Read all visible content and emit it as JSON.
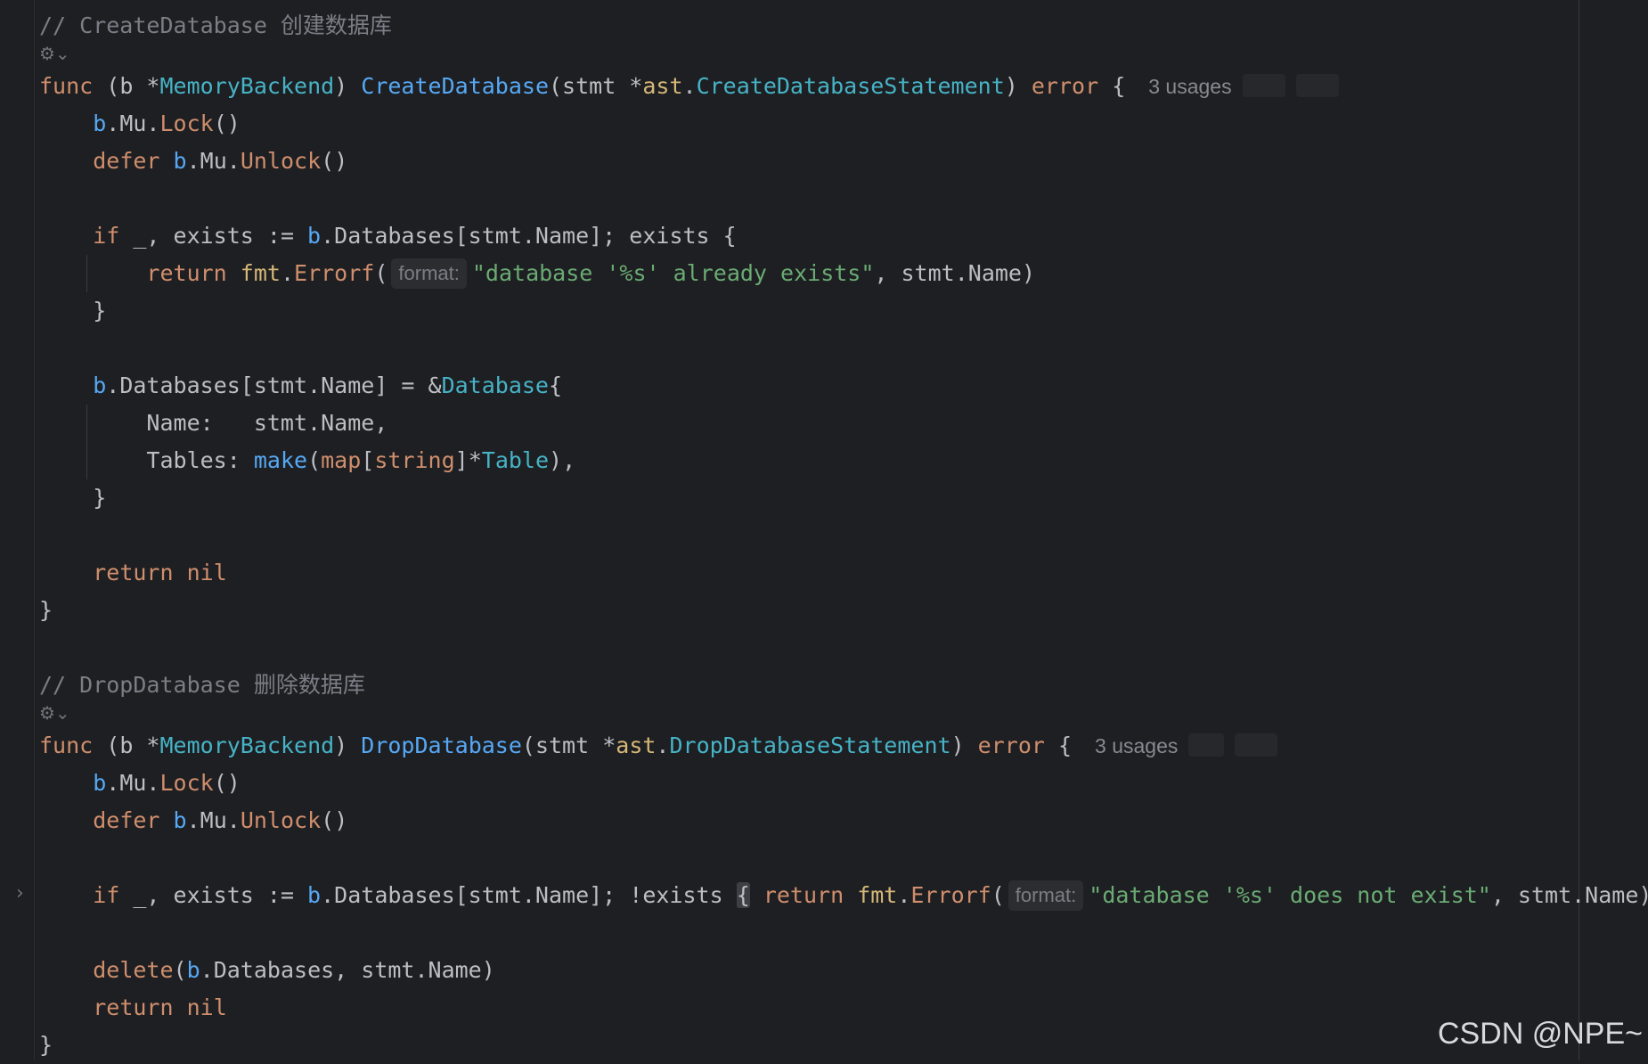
{
  "comment1": "// CreateDatabase 创建数据库",
  "comment2": "// DropDatabase 删除数据库",
  "gutter_icon_symbol": "⚙⌄",
  "usages": "3 usages",
  "hint_format": "format:",
  "create": {
    "recv": "(b *",
    "recv_type": "MemoryBackend",
    "recv_close": ") ",
    "name": "CreateDatabase",
    "param_open": "(stmt *",
    "pkg": "ast",
    "param_type": "CreateDatabaseStatement",
    "ret_err": "error",
    "lock_b": "b",
    "lock_mu": ".Mu.",
    "lock_fn": "Lock",
    "unlock_fn": "Unlock",
    "if_rest": " _, exists := ",
    "if_db": ".Databases[stmt.Name]; exists {",
    "errorf_pkg": "fmt",
    "errorf_fn": "Errorf",
    "err_str": "\"database '%s' already exists\"",
    "err_tail": ", stmt.Name)",
    "assign_rest": ".Databases[stmt.Name] = &",
    "assign_type": "Database",
    "name_field": "Name:   stmt.Name,",
    "tables_field": "Tables: ",
    "make_fn": "make",
    "map_kw": "map",
    "string_kw": "string",
    "table_type": "Table",
    "tail": "),",
    "ret_nil": "nil"
  },
  "drop": {
    "name": "DropDatabase",
    "param_type": "DropDatabaseStatement",
    "if_db": ".Databases[stmt.Name]; !exists ",
    "err_str": "\"database '%s' does not exist\"",
    "err_tail": ", stmt.Name)",
    "delete_fn": "delete",
    "delete_args": ".Databases, stmt.Name)"
  },
  "keywords": {
    "func": "func",
    "defer": "defer",
    "if": "if",
    "return": "return"
  },
  "watermark": "CSDN @NPE~"
}
